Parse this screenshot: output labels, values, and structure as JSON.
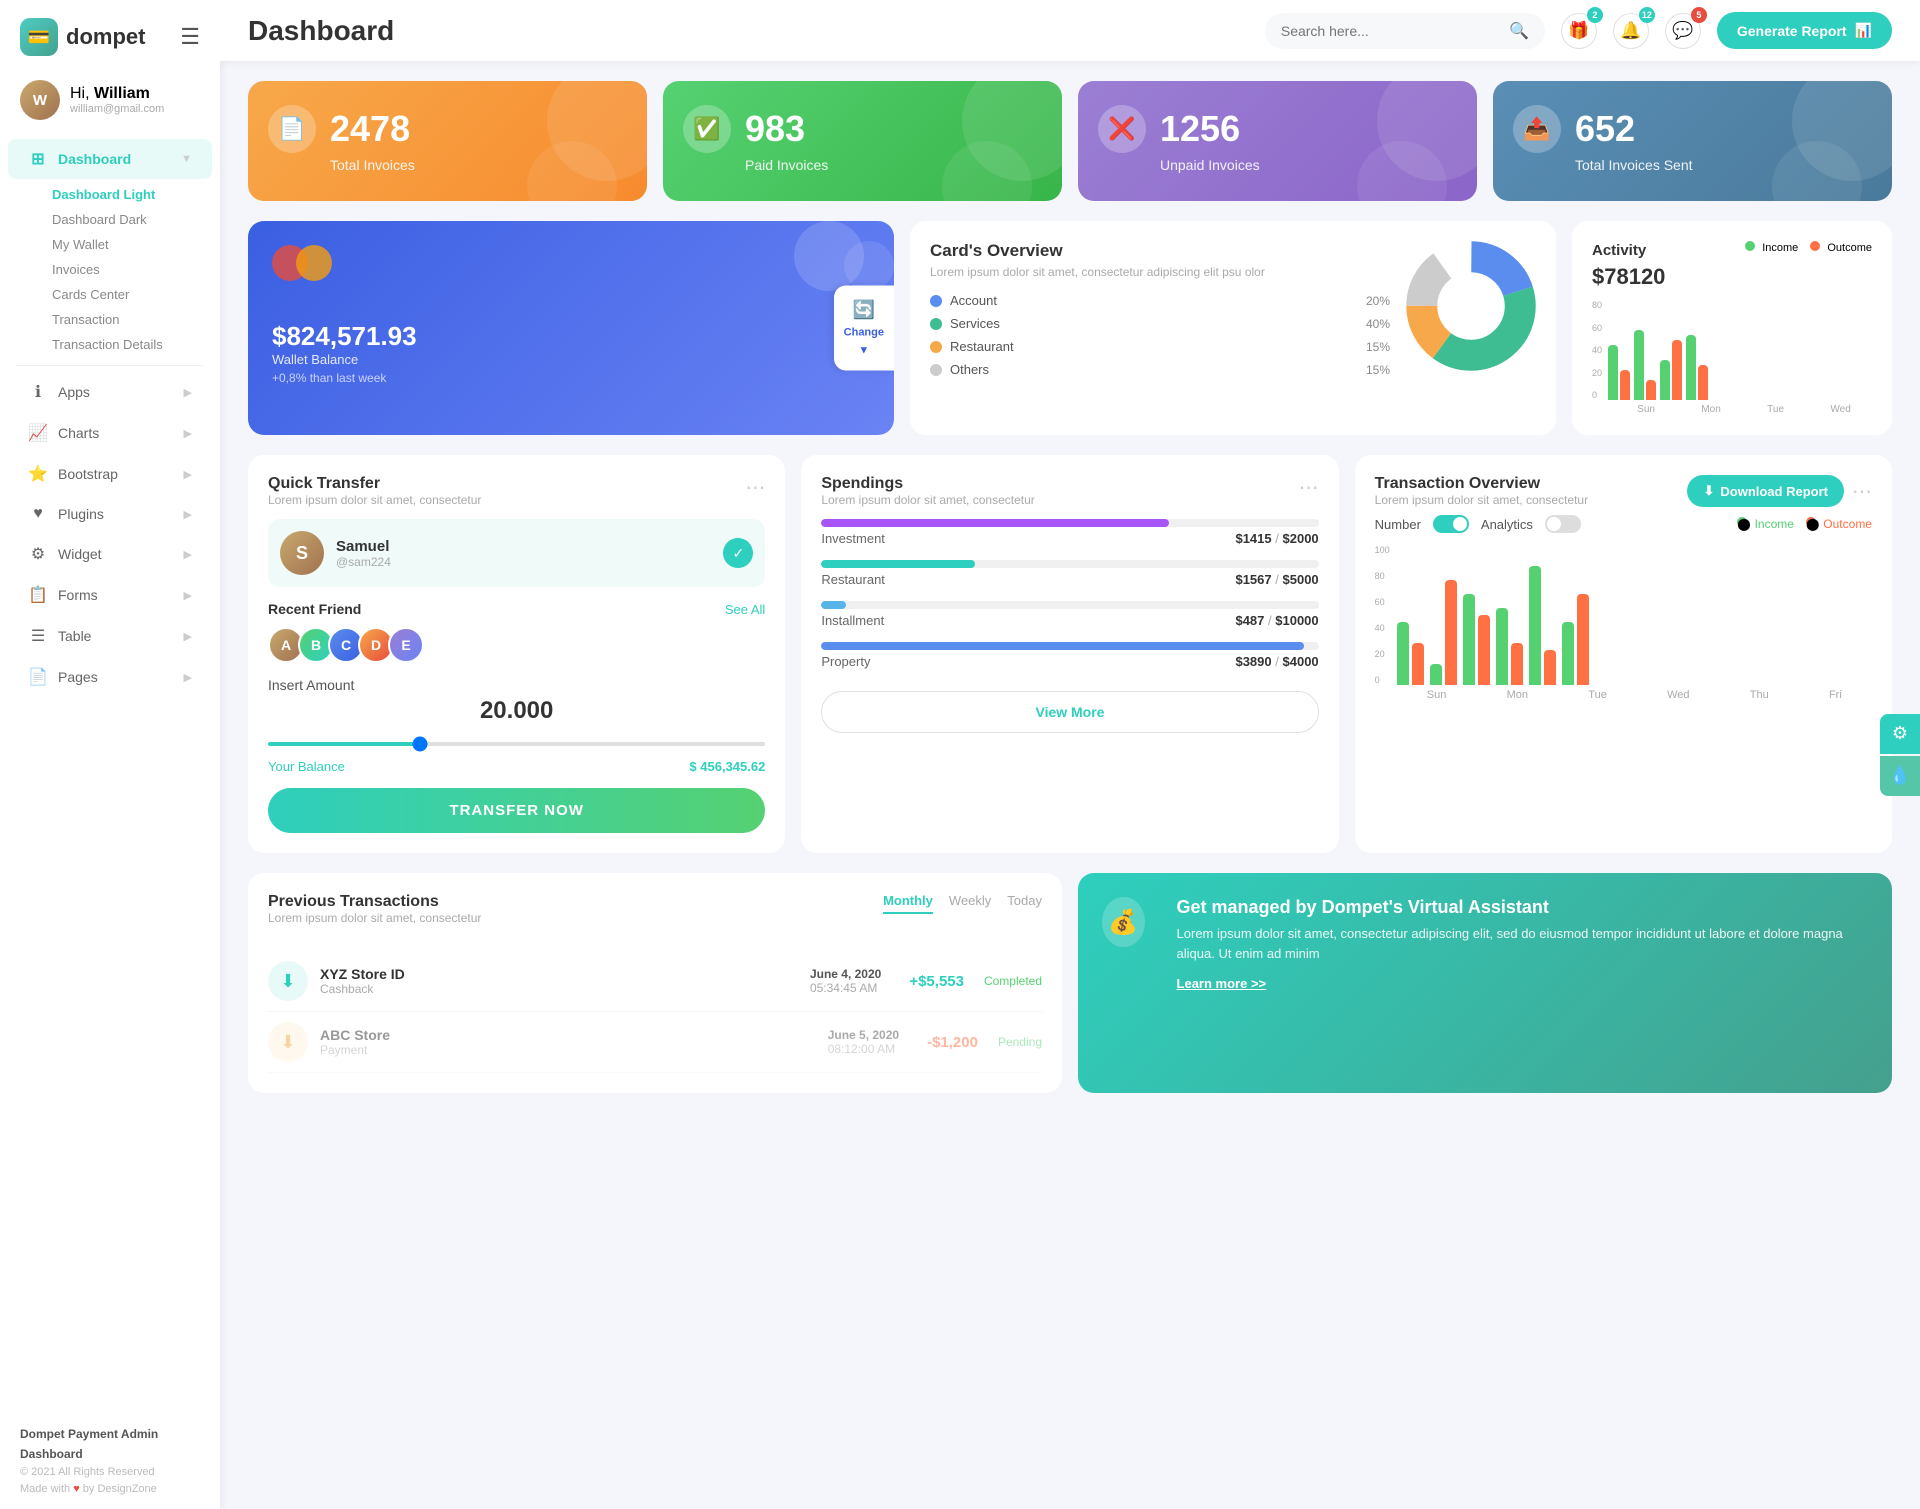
{
  "app": {
    "name": "dompet",
    "logo_symbol": "💳"
  },
  "header": {
    "title": "Dashboard",
    "search_placeholder": "Search here...",
    "generate_btn": "Generate Report",
    "notifications": [
      {
        "icon": "🎁",
        "count": "2",
        "badge_color": "teal"
      },
      {
        "icon": "🔔",
        "count": "12",
        "badge_color": "teal"
      },
      {
        "icon": "💬",
        "count": "5",
        "badge_color": "red"
      }
    ]
  },
  "user": {
    "greeting": "Hi,",
    "name": "William",
    "email": "william@gmail.com",
    "avatar_letter": "W"
  },
  "sidebar": {
    "nav_items": [
      {
        "label": "Dashboard",
        "icon": "⊞",
        "active": true,
        "has_arrow": true
      },
      {
        "label": "Apps",
        "icon": "ℹ",
        "active": false,
        "has_arrow": true
      },
      {
        "label": "Charts",
        "icon": "📈",
        "active": false,
        "has_arrow": true
      },
      {
        "label": "Bootstrap",
        "icon": "⭐",
        "active": false,
        "has_arrow": true
      },
      {
        "label": "Plugins",
        "icon": "♥",
        "active": false,
        "has_arrow": true
      },
      {
        "label": "Widget",
        "icon": "⚙",
        "active": false,
        "has_arrow": true
      },
      {
        "label": "Forms",
        "icon": "📋",
        "active": false,
        "has_arrow": true
      },
      {
        "label": "Table",
        "icon": "☰",
        "active": false,
        "has_arrow": true
      },
      {
        "label": "Pages",
        "icon": "📄",
        "active": false,
        "has_arrow": true
      }
    ],
    "sub_items": [
      {
        "label": "Dashboard Light",
        "active": true
      },
      {
        "label": "Dashboard Dark",
        "active": false
      },
      {
        "label": "My Wallet",
        "active": false
      },
      {
        "label": "Invoices",
        "active": false
      },
      {
        "label": "Cards Center",
        "active": false
      },
      {
        "label": "Transaction",
        "active": false
      },
      {
        "label": "Transaction Details",
        "active": false
      }
    ],
    "footer": {
      "brand": "Dompet Payment Admin Dashboard",
      "copyright": "© 2021 All Rights Reserved",
      "made_with": "Made with",
      "by": "by DesignZone"
    }
  },
  "stat_cards": [
    {
      "label": "Total Invoices",
      "value": "2478",
      "color": "orange",
      "icon": "📄"
    },
    {
      "label": "Paid Invoices",
      "value": "983",
      "color": "green",
      "icon": "✅"
    },
    {
      "label": "Unpaid Invoices",
      "value": "1256",
      "color": "purple",
      "icon": "❌"
    },
    {
      "label": "Total Invoices Sent",
      "value": "652",
      "color": "teal",
      "icon": "📤"
    }
  ],
  "card_widget": {
    "balance": "$824,571.93",
    "label": "Wallet Balance",
    "change": "+0,8% than last week",
    "change_btn": "Change"
  },
  "card_overview": {
    "title": "Card's Overview",
    "desc": "Lorem ipsum dolor sit amet, consectetur adipiscing elit psu olor",
    "items": [
      {
        "label": "Account",
        "pct": "20%",
        "color": "#5b8dee"
      },
      {
        "label": "Services",
        "pct": "40%",
        "color": "#3ebd93"
      },
      {
        "label": "Restaurant",
        "pct": "15%",
        "color": "#f7a84a"
      },
      {
        "label": "Others",
        "pct": "15%",
        "color": "#ccc"
      }
    ]
  },
  "activity": {
    "title": "Activity",
    "amount": "$78120",
    "income_label": "Income",
    "outcome_label": "Outcome",
    "bars": [
      {
        "day": "Sun",
        "income": 55,
        "outcome": 30
      },
      {
        "day": "Mon",
        "income": 70,
        "outcome": 20
      },
      {
        "day": "Tue",
        "income": 40,
        "outcome": 60
      },
      {
        "day": "Wed",
        "income": 65,
        "outcome": 35
      }
    ]
  },
  "quick_transfer": {
    "title": "Quick Transfer",
    "desc": "Lorem ipsum dolor sit amet, consectetur",
    "contact": {
      "name": "Samuel",
      "handle": "@sam224",
      "avatar_letter": "S"
    },
    "recent_friends_label": "Recent Friend",
    "see_all": "See All",
    "insert_amount_label": "Insert Amount",
    "amount": "20.000",
    "balance_label": "Your Balance",
    "balance_value": "$ 456,345.62",
    "btn_label": "TRANSFER NOW"
  },
  "spendings": {
    "title": "Spendings",
    "desc": "Lorem ipsum dolor sit amet, consectetur",
    "items": [
      {
        "label": "Investment",
        "amount": "$1415",
        "max": "$2000",
        "pct": 70,
        "color": "#a855f7"
      },
      {
        "label": "Restaurant",
        "amount": "$1567",
        "max": "$5000",
        "pct": 31,
        "color": "#2ecfbe"
      },
      {
        "label": "Installment",
        "amount": "$487",
        "max": "$10000",
        "pct": 5,
        "color": "#56b4e9"
      },
      {
        "label": "Property",
        "amount": "$3890",
        "max": "$4000",
        "pct": 97,
        "color": "#5b8dee"
      }
    ],
    "view_more_btn": "View More"
  },
  "transaction_overview": {
    "title": "Transaction Overview",
    "desc": "Lorem ipsum dolor sit amet, consectetur",
    "download_btn": "Download Report",
    "toggle_number_label": "Number",
    "toggle_analytics_label": "Analytics",
    "income_label": "Income",
    "outcome_label": "Outcome",
    "bars": [
      {
        "day": "Sun",
        "income": 45,
        "outcome": 30
      },
      {
        "day": "Mon",
        "income": 15,
        "outcome": 75
      },
      {
        "day": "Tue",
        "income": 65,
        "outcome": 50
      },
      {
        "day": "Wed",
        "income": 55,
        "outcome": 30
      },
      {
        "day": "Thu",
        "income": 85,
        "outcome": 25
      },
      {
        "day": "Fri",
        "income": 45,
        "outcome": 65
      }
    ],
    "y_labels": [
      "0",
      "20",
      "40",
      "60",
      "80",
      "100"
    ]
  },
  "prev_transactions": {
    "title": "Previous Transactions",
    "desc": "Lorem ipsum dolor sit amet, consectetur",
    "tabs": [
      "Monthly",
      "Weekly",
      "Today"
    ],
    "active_tab": "Monthly",
    "items": [
      {
        "name": "XYZ Store ID",
        "type": "Cashback",
        "date": "June 4, 2020",
        "time": "05:34:45 AM",
        "amount": "+$5,553",
        "status": "Completed",
        "icon": "⬇"
      }
    ]
  },
  "virtual_assistant": {
    "title": "Get managed by Dompet's Virtual Assistant",
    "desc": "Lorem ipsum dolor sit amet, consectetur adipiscing elit, sed do eiusmod tempor incididunt ut labore et dolore magna aliqua. Ut enim ad minim",
    "link": "Learn more >>"
  },
  "colors": {
    "primary": "#2ecfbe",
    "orange": "#f7a84a",
    "green": "#56d172",
    "purple": "#9b7fd4",
    "teal": "#5a8eb5",
    "income_bar": "#56d172",
    "outcome_bar": "#ff7043"
  }
}
